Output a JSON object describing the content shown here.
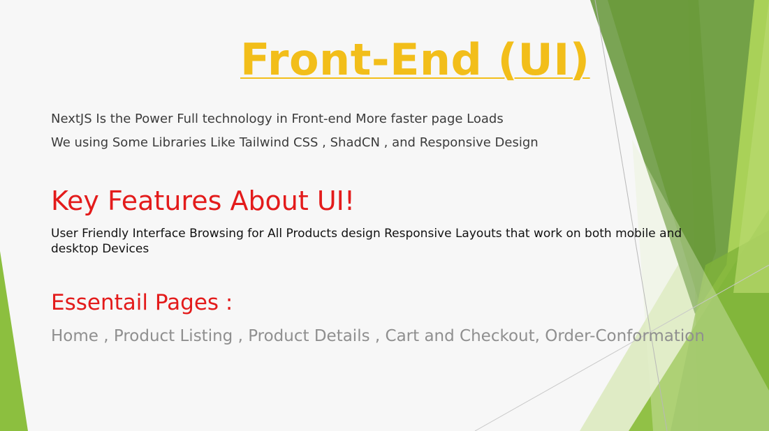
{
  "slide": {
    "title": "Front-End (UI)",
    "intro_lines": [
      "NextJS Is the Power Full technology in Front-end More faster page Loads",
      "We using Some Libraries Like Tailwind CSS , ShadCN , and Responsive Design"
    ],
    "features": {
      "heading": "Key Features About UI!",
      "text": "User Friendly Interface Browsing for All Products design Responsive Layouts  that work on  both mobile and desktop Devices"
    },
    "pages": {
      "heading": "Essentail Pages :",
      "text": "Home , Product Listing , Product Details , Cart and Checkout, Order-Conformation"
    }
  },
  "colors": {
    "background": "#f7f7f7",
    "title": "#f2be1a",
    "heading": "#e31b1b",
    "body_text": "#3b3b3b",
    "feature_text": "#111111",
    "pages_text": "#8f8f8f",
    "green_dark": "#6f9c45",
    "green_mid": "#8cbf3f",
    "green_light": "#a9d158",
    "green_pale": "#d8e8b6"
  }
}
